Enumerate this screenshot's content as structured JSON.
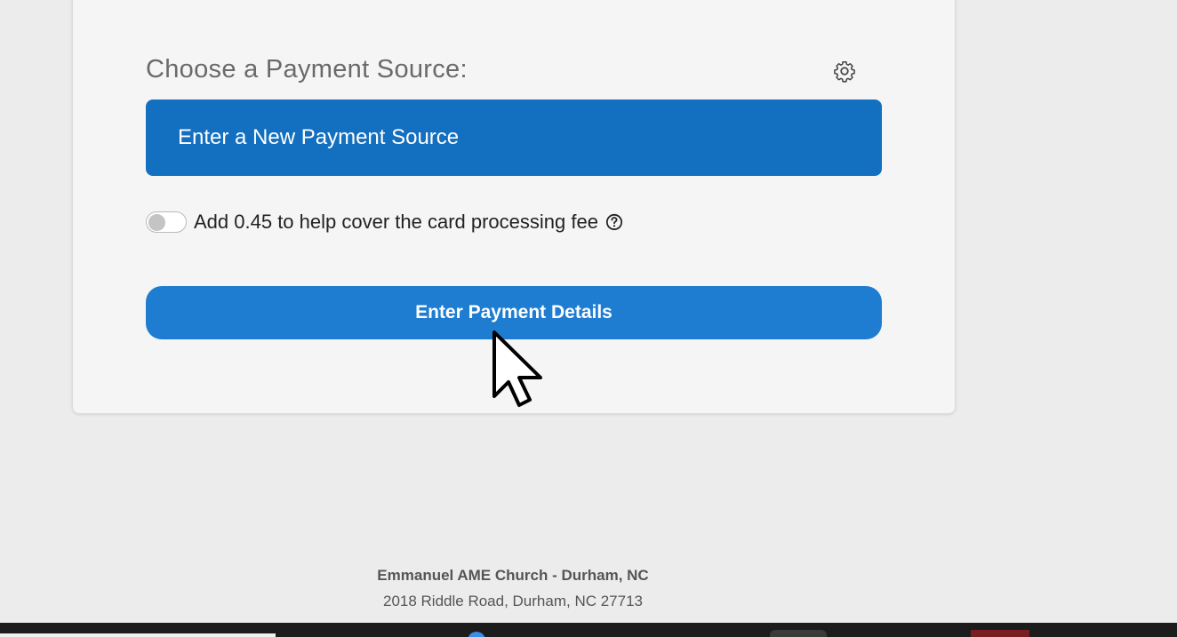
{
  "payment": {
    "heading": "Choose a Payment Source:",
    "new_source_label": "Enter a New Payment Source",
    "fee_text": "Add 0.45 to help cover the card processing fee",
    "fee_toggle_on": false,
    "details_button_label": "Enter Payment Details"
  },
  "footer": {
    "organization": "Emmanuel AME Church - Durham, NC",
    "address": "2018 Riddle Road, Durham, NC 27713"
  },
  "icons": {
    "settings": "gear-icon",
    "help": "question-circle-icon",
    "pointer": "mouse-pointer-icon"
  },
  "colors": {
    "primary": "#136fbf",
    "primary_light": "#1e7dd1",
    "card_bg": "#f5f5f5",
    "page_bg": "#ececec"
  }
}
